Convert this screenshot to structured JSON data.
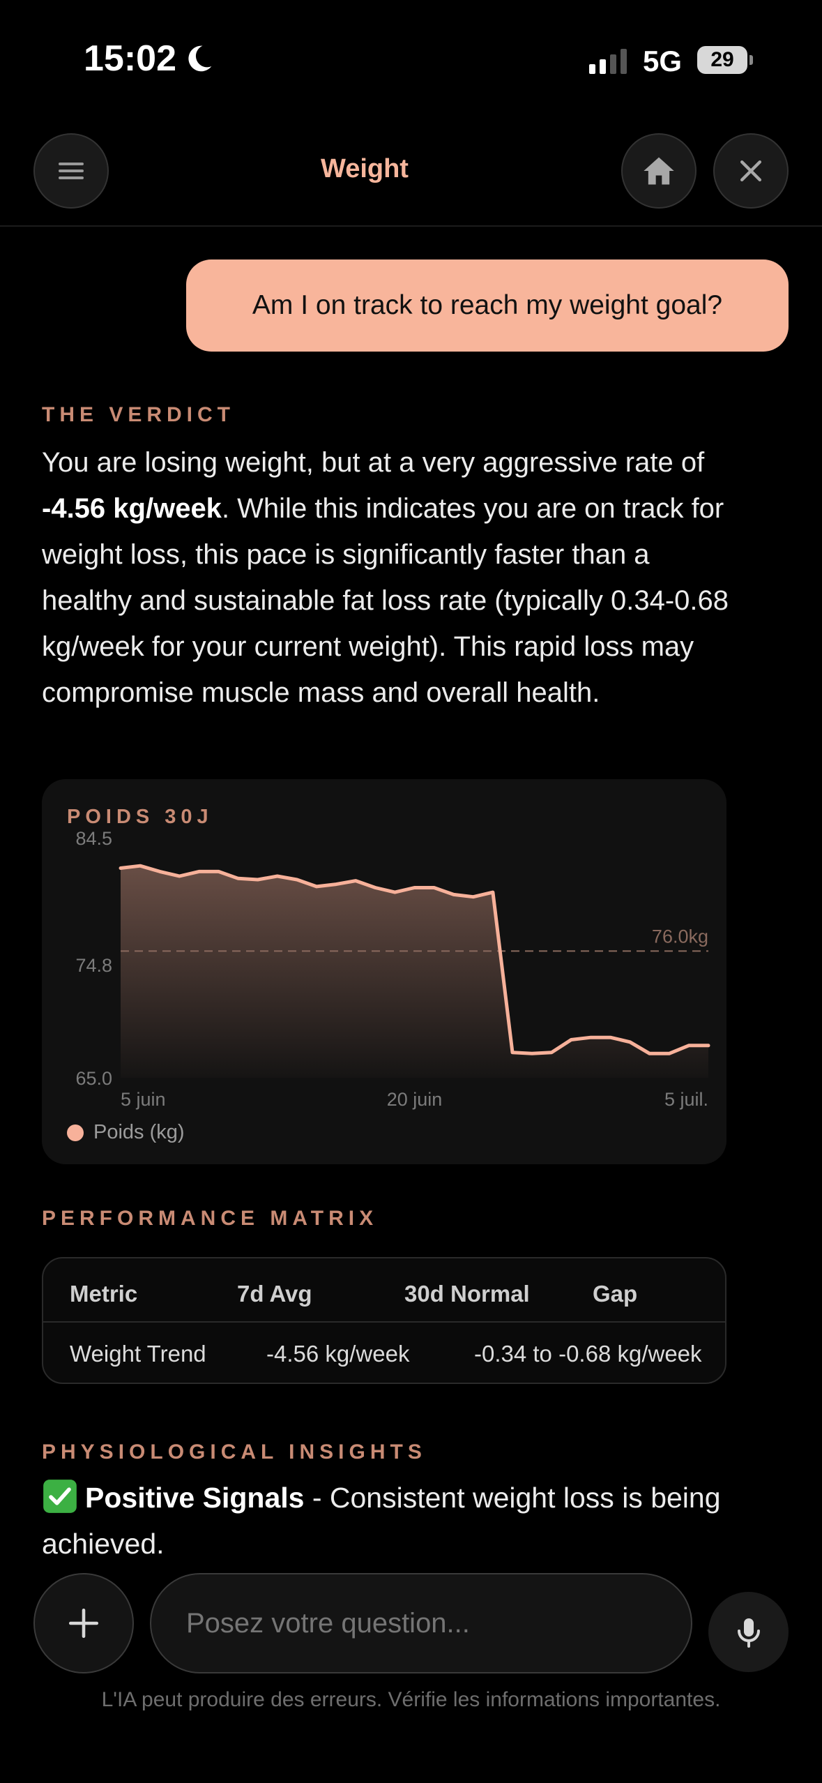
{
  "status_bar": {
    "time": "15:02",
    "network": "5G",
    "battery": "29",
    "icons": [
      "moon-icon",
      "signal-icon",
      "battery-icon"
    ]
  },
  "header": {
    "title": "Weight",
    "icons": [
      "menu-icon",
      "home-icon",
      "close-icon"
    ]
  },
  "chat": {
    "user_message": "Am I on track to reach my weight goal?"
  },
  "verdict": {
    "heading": "THE VERDICT",
    "text_before": "You are losing weight, but at a very aggressive rate of ",
    "emphasis": "-4.56 kg/week",
    "text_after": ". While this indicates you are on track for weight loss, this pace is significantly faster than a healthy and sustainable fat loss rate (typically 0.34-0.68 kg/week for your current weight). This rapid loss may compromise muscle mass and overall health."
  },
  "chart_card": {
    "title": "POIDS 30J",
    "legend": "Poids (kg)"
  },
  "chart_data": {
    "type": "area",
    "title": "POIDS 30J",
    "x_tick_labels": [
      "5 juin",
      "20 juin",
      "5 juil."
    ],
    "y_tick_labels": [
      "84.5",
      "74.8",
      "65.0"
    ],
    "ylim": [
      65.0,
      84.5
    ],
    "target_line": {
      "value": 76.0,
      "label": "76.0kg"
    },
    "series": [
      {
        "name": "Poids (kg)",
        "color": "#f7b19a",
        "values": [
          83.2,
          83.4,
          82.9,
          82.5,
          82.9,
          82.9,
          82.3,
          82.2,
          82.5,
          82.2,
          81.6,
          81.8,
          82.1,
          81.5,
          81.1,
          81.5,
          81.5,
          80.9,
          80.7,
          81.1,
          67.2,
          67.1,
          67.2,
          68.3,
          68.5,
          68.5,
          68.1,
          67.1,
          67.1,
          67.8,
          67.8
        ]
      }
    ],
    "grid": false,
    "legend_position": "bottom-left"
  },
  "performance": {
    "heading": "PERFORMANCE MATRIX",
    "columns": [
      "Metric",
      "7d Avg",
      "30d Normal",
      "Gap"
    ],
    "rows": [
      [
        "Weight Trend",
        "-4.56 kg/week",
        "-0.34 to -0.68 kg/week",
        ""
      ]
    ]
  },
  "insights": {
    "heading": "PHYSIOLOGICAL INSIGHTS",
    "item_title": "Positive Signals",
    "item_text": " - Consistent weight loss is being achieved."
  },
  "composer": {
    "placeholder": "Posez votre question...",
    "disclaimer": "L'IA peut produire des erreurs. Vérifie les informations importantes.",
    "icons": [
      "plus-icon",
      "microphone-icon"
    ]
  },
  "colors": {
    "accent": "#f8b59b",
    "section_heading": "#c98b74",
    "background": "#000000"
  }
}
